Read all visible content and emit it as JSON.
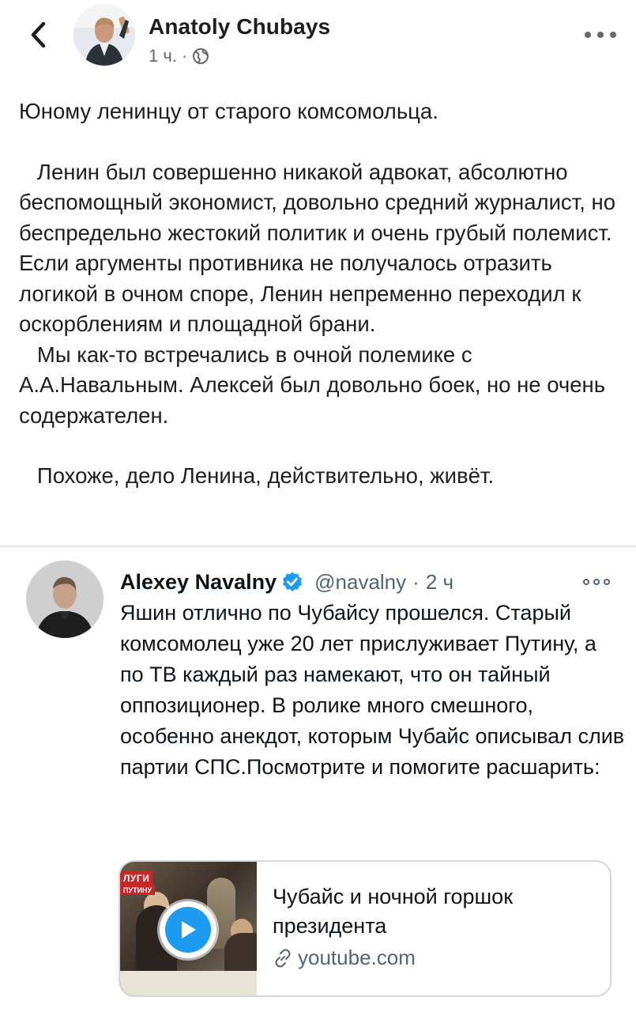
{
  "colors": {
    "text": "#1c1e21",
    "meta": "#65676b",
    "twitter_blue": "#1d9bf0",
    "tweet_muted": "#536471",
    "border": "#cfd9de"
  },
  "post": {
    "author": "Anatoly Chubays",
    "time": "1 ч.",
    "separator": "·",
    "privacy_icon": "globe-icon",
    "paragraphs": [
      "Юному ленинцу от старого комсомольца.",
      "   Ленин был совершенно никакой адвокат, абсолютно беспомощный экономист, довольно средний журналист, но беспредельно жестокий политик и очень грубый полемист. Если аргументы противника не получалось отразить логикой в очном споре, Ленин непременно переходил к оскорблениям и площадной брани.",
      "   Мы как-то встречались в очной полемике с А.А.Навальным. Алексей был довольно боек, но не очень содержателен.",
      "   Похоже, дело Ленина, действительно, живёт."
    ]
  },
  "tweet": {
    "name": "Alexey Navalny",
    "handle": "@navalny",
    "separator": "·",
    "time": "2 ч",
    "text": "Яшин отлично по Чубайсу прошелся. Старый комсомолец уже 20 лет прислуживает Путину, а по ТВ каждый раз намекают, что он тайный оппозиционер. В ролике много смешного, особенно анекдот, которым Чубайс описывал слив партии СПС.Посмотрите и помогите расшарить:",
    "card": {
      "title": "Чубайс и ночной горшок президента",
      "domain": "youtube.com",
      "thumb_tag_1": "ЛУГИ",
      "thumb_tag_2": "ПУТИНУ"
    }
  }
}
